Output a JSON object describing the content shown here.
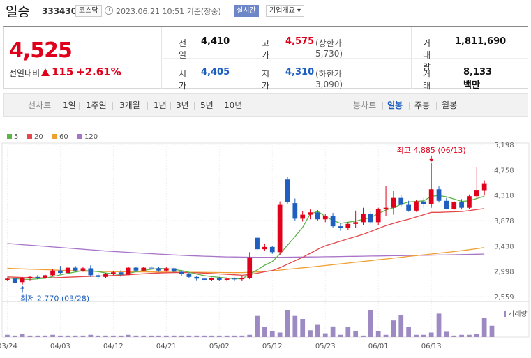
{
  "header": {
    "name": "일승",
    "code": "333430",
    "market": "코스닥",
    "base_time": "2023.06.21 10:51 기준(장중)",
    "realtime_label": "실시간",
    "overview_label": "기업개요 ▾"
  },
  "summary": {
    "price": "4,525",
    "change_label": "전일대비",
    "change_value": "115",
    "change_pct": "+2.61%",
    "prev_close_label": "전일",
    "prev_close": "4,410",
    "high_label": "고가",
    "high": "4,575",
    "upper_limit": "(상한가 5,730)",
    "volume_label": "거래량",
    "volume": "1,811,690",
    "open_label": "시가",
    "open": "4,405",
    "low_label": "저가",
    "low": "4,310",
    "lower_limit": "(하한가 3,090)",
    "amount_label": "거래대금",
    "amount": "8,133 백만"
  },
  "period_bar": {
    "line_label": "선차트",
    "line_periods": [
      "1일",
      "1주일",
      "3개월",
      "1년",
      "3년",
      "5년",
      "10년"
    ],
    "candle_label": "봉차트",
    "candle_periods": [
      "일봉",
      "주봉",
      "월봉"
    ],
    "active_candle": "일봉"
  },
  "colors": {
    "up": "#e0001b",
    "down": "#1e5fbf",
    "ma5": "#5cb548",
    "ma20": "#e5474a",
    "ma60": "#f0a033",
    "ma120": "#a874c9",
    "volume": "#9d8ac2"
  },
  "chart_data": {
    "type": "candlestick",
    "ylim": [
      2559,
      5198
    ],
    "yticks": [
      "5,198",
      "4,758",
      "4,318",
      "3,878",
      "3,438",
      "2,998",
      "2,559"
    ],
    "xticks": [
      "03/24",
      "04/03",
      "04/12",
      "04/21",
      "05/02",
      "05/12",
      "05/23",
      "06/01",
      "06/13"
    ],
    "xtick_index": [
      0,
      7,
      14,
      21,
      28,
      35,
      42,
      49,
      56
    ],
    "legend": [
      "5",
      "20",
      "60",
      "120"
    ],
    "volume_legend": "거래량",
    "max_annotation": "최고 4,885 (06/13)",
    "min_annotation": "최저 2,770 (03/28)",
    "max_index": 56,
    "max_value": 4885,
    "min_index": 2,
    "min_value": 2770,
    "candles": [
      [
        2850,
        2880,
        2840,
        2870
      ],
      [
        2870,
        2880,
        2790,
        2800
      ],
      [
        2810,
        2900,
        2770,
        2880
      ],
      [
        2880,
        2920,
        2840,
        2900
      ],
      [
        2900,
        2930,
        2860,
        2880
      ],
      [
        2880,
        2950,
        2860,
        2930
      ],
      [
        2930,
        3040,
        2920,
        3010
      ],
      [
        3010,
        3090,
        2950,
        2970
      ],
      [
        2970,
        3080,
        2960,
        3060
      ],
      [
        3060,
        3090,
        2990,
        3010
      ],
      [
        3010,
        3070,
        2990,
        3050
      ],
      [
        3050,
        3100,
        2900,
        2930
      ],
      [
        2930,
        2970,
        2860,
        2900
      ],
      [
        2900,
        2970,
        2880,
        2950
      ],
      [
        2950,
        3000,
        2930,
        2980
      ],
      [
        2980,
        3020,
        2900,
        2940
      ],
      [
        2940,
        3080,
        2930,
        3060
      ],
      [
        3060,
        3080,
        2990,
        3010
      ],
      [
        3010,
        3080,
        3000,
        3060
      ],
      [
        3060,
        3090,
        3030,
        3050
      ],
      [
        3050,
        3070,
        2990,
        3010
      ],
      [
        3010,
        3070,
        2990,
        3050
      ],
      [
        3050,
        3060,
        2970,
        2990
      ],
      [
        2990,
        3010,
        2920,
        2950
      ],
      [
        2950,
        2970,
        2880,
        2900
      ],
      [
        2900,
        2920,
        2840,
        2870
      ],
      [
        2870,
        2900,
        2830,
        2850
      ],
      [
        2850,
        2890,
        2830,
        2880
      ],
      [
        2880,
        2900,
        2830,
        2850
      ],
      [
        2850,
        2890,
        2830,
        2870
      ],
      [
        2870,
        2890,
        2840,
        2860
      ],
      [
        2860,
        2920,
        2830,
        2880
      ],
      [
        2880,
        3330,
        2860,
        3240
      ],
      [
        3580,
        3620,
        3350,
        3380
      ],
      [
        3380,
        3480,
        3350,
        3420
      ],
      [
        3420,
        3440,
        3300,
        3330
      ],
      [
        3330,
        4210,
        3280,
        4150
      ],
      [
        4590,
        4640,
        4170,
        4200
      ],
      [
        4180,
        4260,
        3880,
        3910
      ],
      [
        3910,
        4040,
        3860,
        3980
      ],
      [
        3980,
        4070,
        3900,
        4020
      ],
      [
        4020,
        4060,
        3870,
        3900
      ],
      [
        3900,
        3990,
        3850,
        3960
      ],
      [
        3960,
        4010,
        3760,
        3780
      ],
      [
        3780,
        3840,
        3700,
        3750
      ],
      [
        3750,
        3850,
        3710,
        3820
      ],
      [
        3820,
        4050,
        3750,
        3850
      ],
      [
        3850,
        4100,
        3800,
        4000
      ],
      [
        4000,
        4040,
        3820,
        3850
      ],
      [
        3850,
        4100,
        3800,
        4080
      ],
      [
        4080,
        4480,
        3960,
        4100
      ],
      [
        4100,
        4390,
        3980,
        4270
      ],
      [
        4270,
        4320,
        4120,
        4150
      ],
      [
        4150,
        4220,
        4030,
        4050
      ],
      [
        4050,
        4240,
        4030,
        4210
      ],
      [
        4210,
        4270,
        4100,
        4160
      ],
      [
        4160,
        4885,
        4100,
        4420
      ],
      [
        4420,
        4470,
        4190,
        4220
      ],
      [
        4220,
        4270,
        4070,
        4080
      ],
      [
        4080,
        4220,
        4060,
        4200
      ],
      [
        4200,
        4250,
        4070,
        4100
      ],
      [
        4100,
        4330,
        4080,
        4300
      ],
      [
        4300,
        4810,
        4250,
        4410
      ],
      [
        4405,
        4575,
        4310,
        4525
      ]
    ],
    "ma5": [
      2885,
      2870,
      2860,
      2855,
      2866,
      2877,
      2908,
      2935,
      2962,
      2986,
      3010,
      3004,
      2992,
      2969,
      2952,
      2941,
      2962,
      2990,
      3012,
      3034,
      3048,
      3045,
      3031,
      3009,
      2981,
      2949,
      2923,
      2905,
      2893,
      2880,
      2870,
      2867,
      2948,
      3021,
      3104,
      3166,
      3300,
      3450,
      3600,
      3760,
      3990,
      4040,
      3950,
      3880,
      3830,
      3850,
      3870,
      3900,
      3930,
      4000,
      4060,
      4100,
      4160,
      4200,
      4210,
      4220,
      4300,
      4310,
      4290,
      4250,
      4210,
      4220,
      4260,
      4300
    ],
    "ma20": [
      2900,
      2895,
      2890,
      2887,
      2885,
      2884,
      2886,
      2890,
      2895,
      2900,
      2905,
      2910,
      2915,
      2920,
      2925,
      2930,
      2938,
      2946,
      2955,
      2962,
      2968,
      2972,
      2975,
      2976,
      2975,
      2972,
      2967,
      2960,
      2953,
      2945,
      2938,
      2930,
      2943,
      2965,
      2990,
      3010,
      3060,
      3120,
      3180,
      3240,
      3310,
      3380,
      3440,
      3480,
      3520,
      3560,
      3600,
      3640,
      3690,
      3740,
      3790,
      3830,
      3870,
      3900,
      3940,
      3980,
      4020,
      4020,
      4025,
      4030,
      4035,
      4050,
      4070,
      4085
    ],
    "ma60": [
      3050,
      3045,
      3040,
      3035,
      3030,
      3025,
      3020,
      3015,
      3010,
      3005,
      3000,
      2998,
      2996,
      2994,
      2992,
      2990,
      2989,
      2988,
      2987,
      2986,
      2985,
      2984,
      2983,
      2982,
      2981,
      2980,
      2979,
      2978,
      2977,
      2976,
      2976,
      2976,
      2980,
      2988,
      2997,
      3006,
      3018,
      3032,
      3045,
      3058,
      3070,
      3084,
      3098,
      3112,
      3126,
      3140,
      3154,
      3168,
      3183,
      3198,
      3212,
      3226,
      3241,
      3256,
      3270,
      3284,
      3298,
      3312,
      3326,
      3340,
      3356,
      3372,
      3390,
      3410
    ],
    "ma120": [
      3480,
      3470,
      3460,
      3450,
      3440,
      3430,
      3420,
      3410,
      3400,
      3390,
      3380,
      3370,
      3360,
      3350,
      3342,
      3334,
      3326,
      3318,
      3310,
      3303,
      3296,
      3289,
      3282,
      3276,
      3270,
      3265,
      3260,
      3256,
      3252,
      3248,
      3246,
      3244,
      3243,
      3242,
      3242,
      3242,
      3242,
      3243,
      3244,
      3245,
      3246,
      3248,
      3250,
      3252,
      3254,
      3256,
      3258,
      3260,
      3262,
      3264,
      3266,
      3268,
      3270,
      3272,
      3274,
      3276,
      3278,
      3280,
      3282,
      3285,
      3288,
      3291,
      3294,
      3298
    ],
    "volume": [
      3,
      2,
      4,
      2,
      2,
      2,
      3,
      2,
      2,
      2,
      2,
      3,
      2,
      2,
      2,
      2,
      3,
      2,
      2,
      2,
      2,
      2,
      2,
      2,
      2,
      2,
      2,
      2,
      2,
      2,
      2,
      2,
      3,
      28,
      13,
      8,
      6,
      36,
      28,
      24,
      9,
      17,
      5,
      14,
      3,
      13,
      8,
      2,
      36,
      8,
      3,
      22,
      29,
      13,
      3,
      3,
      6,
      31,
      7,
      2,
      3,
      3,
      4,
      25,
      15
    ]
  }
}
